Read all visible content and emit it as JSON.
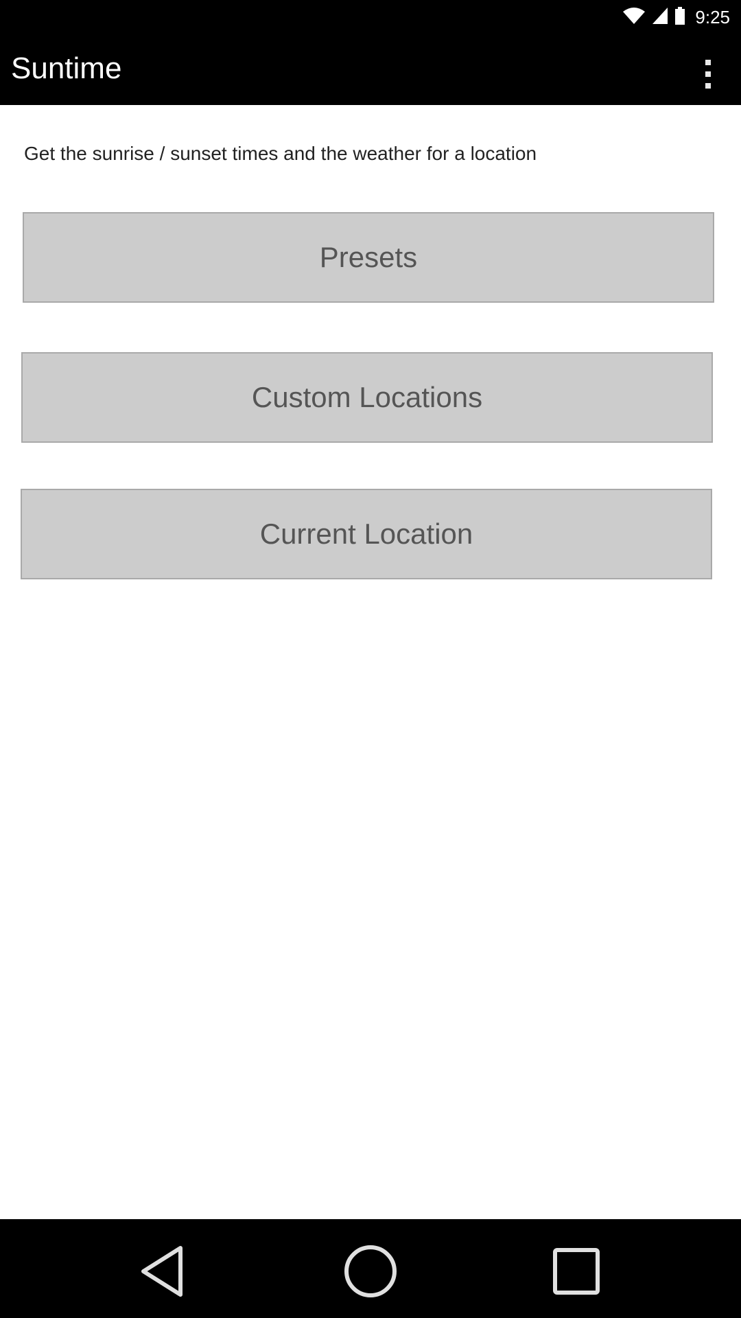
{
  "status_bar": {
    "time": "9:25",
    "icons": [
      "wifi-icon",
      "signal-icon",
      "battery-icon"
    ]
  },
  "app_bar": {
    "title": "Suntime",
    "menu_icon": "overflow-menu-icon"
  },
  "main": {
    "subtitle": "Get the sunrise / sunset times and the weather for a location",
    "buttons": [
      {
        "label": "Presets"
      },
      {
        "label": "Custom Locations"
      },
      {
        "label": "Current Location"
      }
    ]
  },
  "nav_bar": {
    "icons": [
      "back-icon",
      "home-icon",
      "recents-icon"
    ]
  },
  "colors": {
    "bar_background": "#000000",
    "button_background": "#cccccc",
    "button_text": "#555555"
  }
}
